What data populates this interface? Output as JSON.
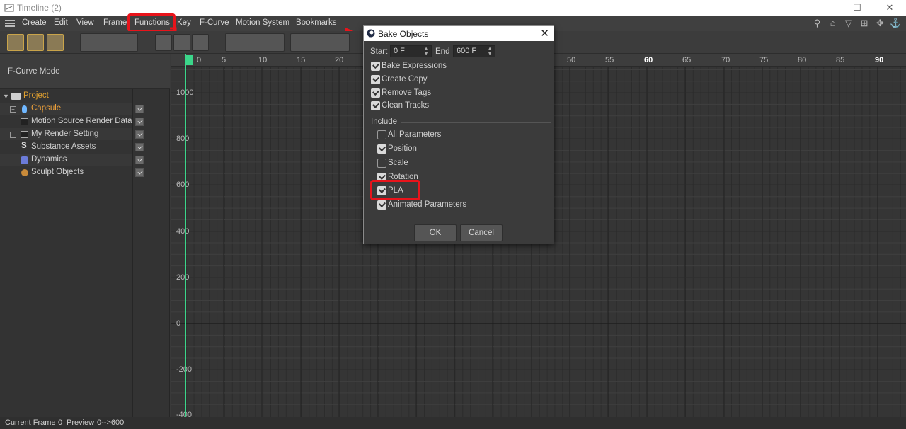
{
  "window": {
    "title": "Timeline (2)",
    "controls": [
      "–",
      "☐",
      "✕"
    ]
  },
  "menu": {
    "items": [
      "Create",
      "Edit",
      "View",
      "Frame",
      "Functions",
      "Key",
      "F-Curve",
      "Motion System",
      "Bookmarks"
    ]
  },
  "left_panel": {
    "mode_label": "F-Curve Mode",
    "tree": [
      {
        "label": "Project",
        "color": "#e0a030"
      },
      {
        "label": "Capsule",
        "color": "#f0a23a"
      },
      {
        "label": "Motion Source Render Data",
        "color": "#cfcfcf"
      },
      {
        "label": "My Render Setting",
        "color": "#cfcfcf"
      },
      {
        "label": "Substance Assets",
        "color": "#cfcfcf"
      },
      {
        "label": "Dynamics",
        "color": "#cfcfcf"
      },
      {
        "label": "Sculpt Objects",
        "color": "#cfcfcf"
      }
    ]
  },
  "ruler": {
    "ticks": [
      "0",
      "5",
      "10",
      "15",
      "20",
      "50",
      "55",
      "60",
      "65",
      "70",
      "75",
      "80",
      "85",
      "90"
    ]
  },
  "graph": {
    "y_labels": [
      "1000",
      "800",
      "600",
      "400",
      "200",
      "0",
      "-200",
      "-400"
    ]
  },
  "status": {
    "current_frame_label": "Current Frame",
    "current_frame_value": "0",
    "preview_label": "Preview",
    "preview_value": "0-->600"
  },
  "dialog": {
    "title": "Bake Objects",
    "start_label": "Start",
    "start_value": "0 F",
    "end_label": "End",
    "end_value": "600 F",
    "options": [
      {
        "label": "Bake Expressions",
        "checked": true
      },
      {
        "label": "Create Copy",
        "checked": true
      },
      {
        "label": "Remove Tags",
        "checked": true
      },
      {
        "label": "Clean Tracks",
        "checked": true
      }
    ],
    "include_label": "Include",
    "include": [
      {
        "label": "All Parameters",
        "checked": false
      },
      {
        "label": "Position",
        "checked": true
      },
      {
        "label": "Scale",
        "checked": false
      },
      {
        "label": "Rotation",
        "checked": true
      },
      {
        "label": "PLA",
        "checked": true
      },
      {
        "label": "Animated Parameters",
        "checked": true
      }
    ],
    "ok_label": "OK",
    "cancel_label": "Cancel"
  },
  "colors": {
    "highlight": "#e8141b",
    "playhead": "#3bd68a",
    "accent_orange": "#e0a030"
  }
}
